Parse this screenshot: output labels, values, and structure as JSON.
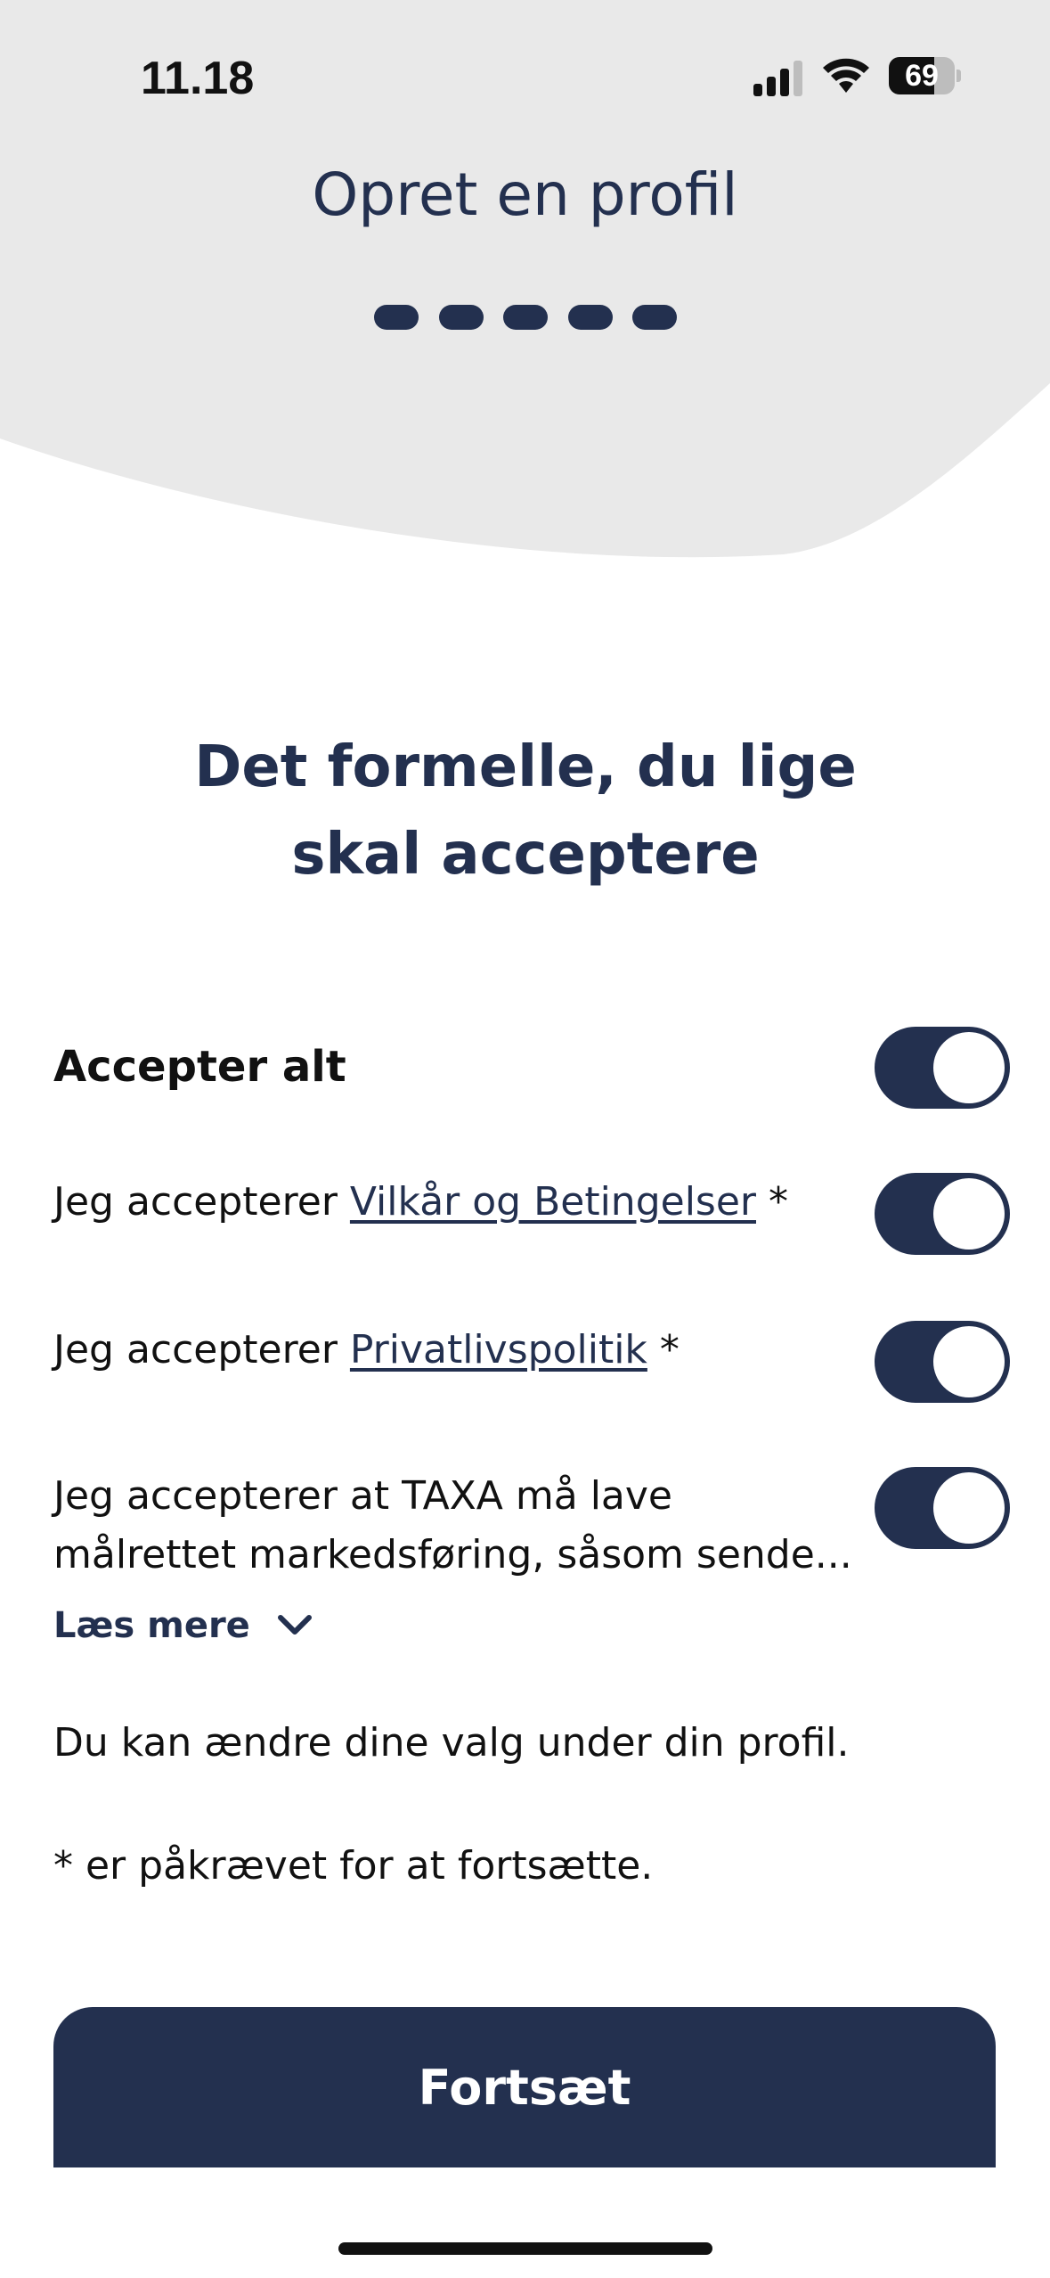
{
  "status_bar": {
    "time": "11.18",
    "battery_level": "69",
    "battery_fraction": 0.69,
    "signal_icon": "cellular-signal-icon",
    "wifi_icon": "wifi-icon"
  },
  "header": {
    "title": "Opret en profil",
    "steps_total": 5,
    "steps_completed": 5,
    "background_color": "#e9e9e9"
  },
  "main": {
    "heading_line1": "Det formelle, du lige",
    "heading_line2": "skal acceptere",
    "accept_all": {
      "label": "Accepter alt",
      "on": true
    },
    "terms": {
      "prefix": "Jeg accepterer ",
      "link": "Vilkår og Betingelser",
      "suffix": " *",
      "on": true
    },
    "privacy": {
      "prefix": "Jeg accepterer ",
      "link": "Privatlivspolitik",
      "suffix": " *",
      "on": true
    },
    "marketing": {
      "line1": "Jeg accepterer at TAXA må lave",
      "line2": "målrettet markedsføring, såsom sende...",
      "on": true
    },
    "read_more": {
      "label": "Læs mere",
      "icon": "chevron-down-icon"
    },
    "note_change": "Du kan ændre dine valg under din profil.",
    "note_required": "* er påkrævet for at fortsætte.",
    "continue_label": "Fortsæt"
  },
  "colors": {
    "primary": "#23304f",
    "header_bg": "#e9e9e9",
    "toggle_on": "#23304f"
  }
}
